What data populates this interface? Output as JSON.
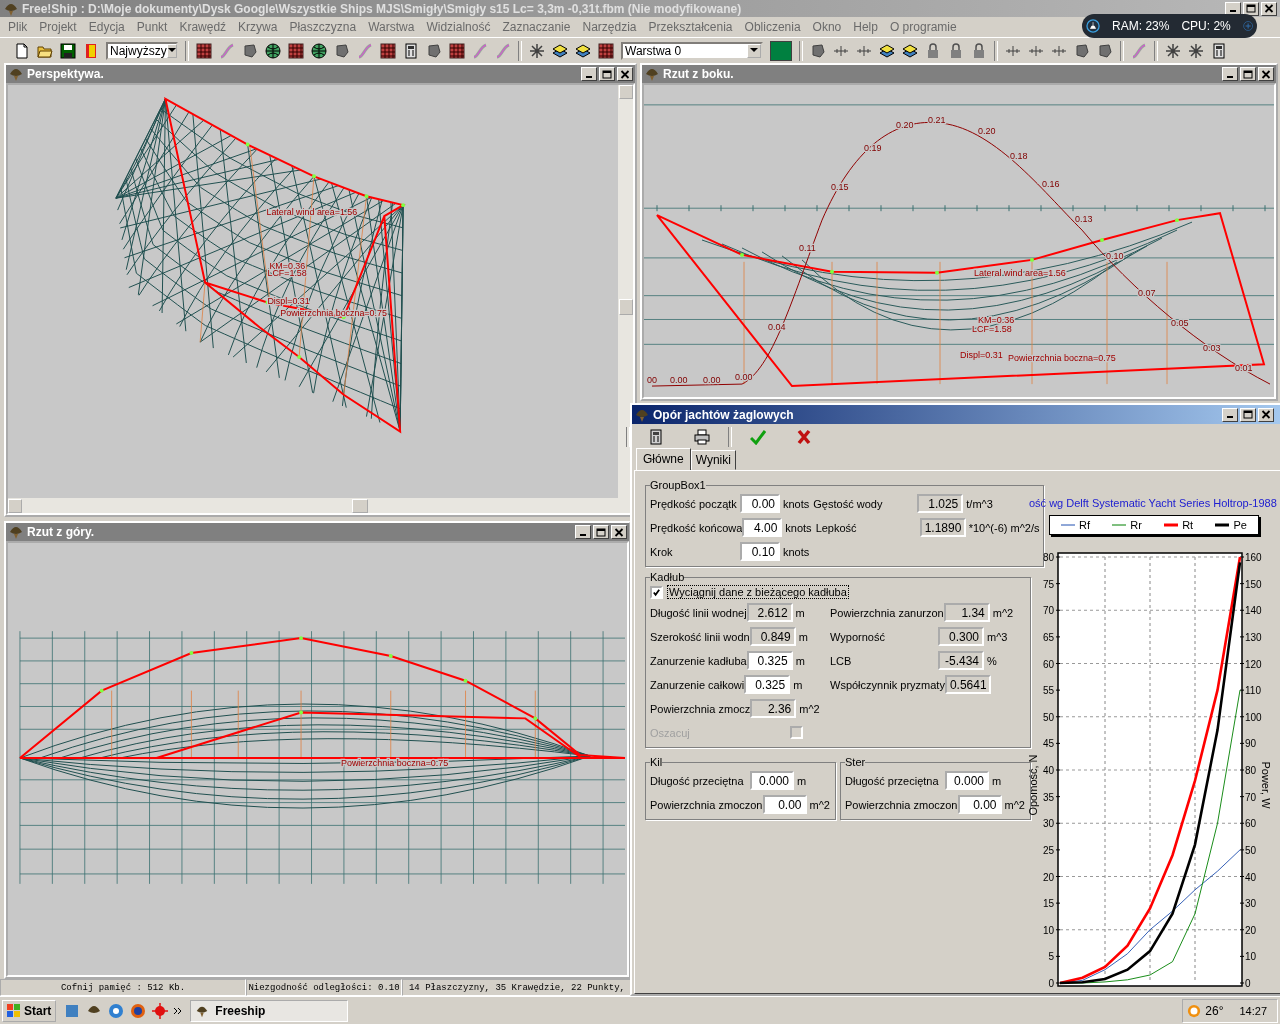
{
  "window": {
    "title": "Free!Ship  : D:\\Moje dokumenty\\Dysk Google\\Wszystkie Ships MJS\\Smigły\\Smigły s15 Lc= 3,3m -0,31t.fbm (Nie modyfikowane)"
  },
  "menu": [
    "Plik",
    "Projekt",
    "Edycja",
    "Punkt",
    "Krawędź",
    "Krzywa",
    "Płaszczyzna",
    "Warstwa",
    "Widzialność",
    "Zaznaczanie",
    "Narzędzia",
    "Przekształcenia",
    "Obliczenia",
    "Okno",
    "Help",
    "O programie"
  ],
  "toolbar": {
    "precision": "Najwyższy",
    "layer": "Warstwa 0"
  },
  "system_monitor": {
    "ram": "RAM: 23%",
    "cpu": "CPU: 2%"
  },
  "viewports": [
    {
      "kind": "perspective",
      "title": "Perspektywa.",
      "labels": [
        "Lateral wind area=1.56",
        "KM=0.36",
        "LCF=1.58",
        "Displ=0.31",
        "Powierzchnia boczna=0.75"
      ]
    },
    {
      "kind": "side",
      "title": "Rzut z boku.",
      "labels": [
        "Lateral wind area=1.56",
        "KM=0.36",
        "LCF=1.58",
        "Displ=0.31",
        "Powierzchnia boczna=0.75"
      ],
      "curve_labels": [
        "00",
        "0.00",
        "0.00",
        "0.00",
        "0.04",
        "0.11",
        "0.15",
        "0.19",
        "0.20",
        "0.21",
        "0.20",
        "0.18",
        "0.16",
        "0.13",
        "0.10",
        "0.07",
        "0.05",
        "0.03",
        "0.01"
      ]
    },
    {
      "kind": "top",
      "title": "Rzut z góry.",
      "labels": [
        "Powierzchnia boczna=0.75"
      ]
    }
  ],
  "status_bar": [
    "Cofnij pamięć : 512 Kb.",
    "Niezgodność odległości: 0.10",
    "14 Płaszczyzny, 35 Krawędzie, 22 Punkty,"
  ],
  "dialog": {
    "title": "Opór jachtów żaglowych",
    "tabs": [
      {
        "label": "Główne",
        "selected": true
      },
      {
        "label": "Wyniki",
        "selected": false
      }
    ],
    "groupbox1": {
      "title": "GroupBox1",
      "rows": [
        [
          {
            "label": "Prędkość początk",
            "value": "0.00",
            "unit": "knots",
            "readonly": false
          },
          {
            "label": "Gęstość wody",
            "value": "1.025",
            "unit": "t/m^3",
            "readonly": true
          }
        ],
        [
          {
            "label": "Prędkość końcowa",
            "value": "4.00",
            "unit": "knots",
            "readonly": false
          },
          {
            "label": "Lepkość",
            "value": "1.1890",
            "unit": "*10^(-6) m^2/s",
            "readonly": true
          }
        ],
        [
          {
            "label": "Krok",
            "value": "0.10",
            "unit": "knots",
            "readonly": false
          }
        ]
      ]
    },
    "hull": {
      "title": "Kadłub",
      "use_current": {
        "label": "Wyciągnij dane z bieżącego kadłuba",
        "checked": true
      },
      "rows": [
        [
          {
            "label": "Długość linii wodnej",
            "value": "2.612",
            "unit": "m",
            "readonly": true
          },
          {
            "label": "Powierzchnia zanurzon",
            "value": "1.34",
            "unit": "m^2",
            "readonly": true
          }
        ],
        [
          {
            "label": "Szerokość linii wodn",
            "value": "0.849",
            "unit": "m",
            "readonly": true
          },
          {
            "label": "Wyporność",
            "value": "0.300",
            "unit": "m^3",
            "readonly": true
          }
        ],
        [
          {
            "label": "Zanurzenie kadłuba",
            "value": "0.325",
            "unit": "m",
            "readonly": false
          },
          {
            "label": "LCB",
            "value": "-5.434",
            "unit": "%",
            "readonly": true
          }
        ],
        [
          {
            "label": "Zanurzenie całkowi",
            "value": "0.325",
            "unit": "m",
            "readonly": false
          },
          {
            "label": "Współczynnik pryzmaty",
            "value": "0.5641",
            "readonly": true
          }
        ],
        [
          {
            "label": "Powierzchnia zmocz",
            "value": "2.36",
            "unit": "m^2",
            "readonly": true
          }
        ]
      ],
      "estimate": {
        "label": "Oszacuj",
        "checked": false,
        "disabled": true
      }
    },
    "appendages": [
      {
        "title": "Kil",
        "rows": [
          [
            {
              "label": "Długość przeciętna",
              "value": "0.000",
              "unit": "m",
              "readonly": false
            }
          ],
          [
            {
              "label": "Powierzchnia zmoczon",
              "value": "0.00",
              "unit": "m^2",
              "readonly": false
            }
          ]
        ]
      },
      {
        "title": "Ster",
        "rows": [
          [
            {
              "label": "Długość przeciętna",
              "value": "0.000",
              "unit": "m",
              "readonly": false
            }
          ],
          [
            {
              "label": "Powierzchnia zmoczon",
              "value": "0.00",
              "unit": "m^2",
              "readonly": false
            }
          ]
        ]
      }
    ],
    "chart_data": {
      "type": "line",
      "title": "ość wg Delft Systematic Yacht Series Holtrop-1988",
      "ylabel": "Opomość, N",
      "y2label": "Power, W",
      "grid": true,
      "ylim": [
        0,
        80
      ],
      "yticks": [
        0,
        5,
        10,
        15,
        20,
        25,
        30,
        35,
        40,
        45,
        50,
        55,
        60,
        65,
        70,
        75,
        80
      ],
      "y2lim": [
        0,
        160
      ],
      "y2ticks": [
        0,
        10,
        20,
        30,
        40,
        50,
        60,
        70,
        80,
        90,
        100,
        110,
        120,
        130,
        140,
        150,
        160
      ],
      "series": [
        {
          "name": "Rf",
          "color": "#2050b0",
          "values": [
            0,
            0.5,
            2.5,
            5.5,
            10,
            13.5,
            17.5,
            21,
            25
          ]
        },
        {
          "name": "Rr",
          "color": "#008000",
          "values": [
            0,
            0,
            0.2,
            0.6,
            1.5,
            4,
            13,
            30,
            55
          ]
        },
        {
          "name": "Rt",
          "color": "#ff0000",
          "values": [
            0,
            1,
            3,
            7,
            14,
            24,
            38,
            55,
            80
          ]
        },
        {
          "name": "Pe",
          "color": "#000000",
          "axis": "y2",
          "values": [
            0,
            0.3,
            1.5,
            5,
            12,
            26,
            52,
            95,
            158
          ]
        }
      ]
    }
  },
  "taskbar": {
    "start": "Start",
    "task": "Freeship",
    "weather": "26°",
    "time": "14:27"
  }
}
